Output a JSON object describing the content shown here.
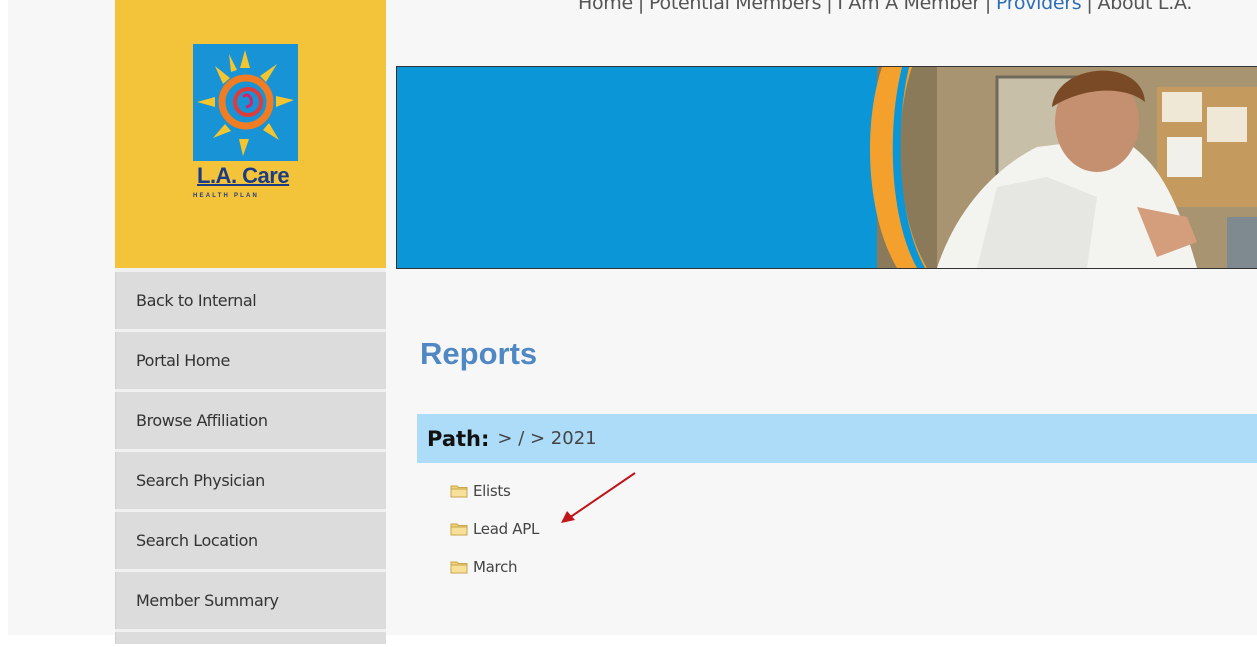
{
  "top_nav": {
    "items": [
      {
        "label": "Home",
        "active": false
      },
      {
        "label": "Potential Members",
        "active": false
      },
      {
        "label": "I Am A Member",
        "active": false
      },
      {
        "label": "Providers",
        "active": true
      },
      {
        "label": "About L.A.",
        "active": false
      }
    ],
    "separator": "|"
  },
  "logo": {
    "name": "L.A. Care",
    "subtitle": "HEALTH PLAN"
  },
  "sidebar": {
    "items": [
      {
        "label": "Back to Internal"
      },
      {
        "label": "Portal Home"
      },
      {
        "label": "Browse Affiliation"
      },
      {
        "label": "Search Physician"
      },
      {
        "label": "Search Location"
      },
      {
        "label": "Member Summary"
      }
    ]
  },
  "main": {
    "title": "Reports",
    "path_label": "Path:",
    "path_value": "> / > 2021",
    "folders": [
      {
        "label": "Elists",
        "icon": "folder-icon"
      },
      {
        "label": "Lead APL",
        "icon": "folder-icon"
      },
      {
        "label": "March",
        "icon": "folder-icon"
      }
    ]
  },
  "colors": {
    "logo_background": "#f3c43a",
    "brand_blue": "#1b3b86",
    "banner_blue": "#0b96d8",
    "title_blue": "#4f88c2",
    "path_bar": "#acdcf7",
    "active_nav": "#2f6eb5",
    "annotation_arrow": "#c0161b"
  }
}
